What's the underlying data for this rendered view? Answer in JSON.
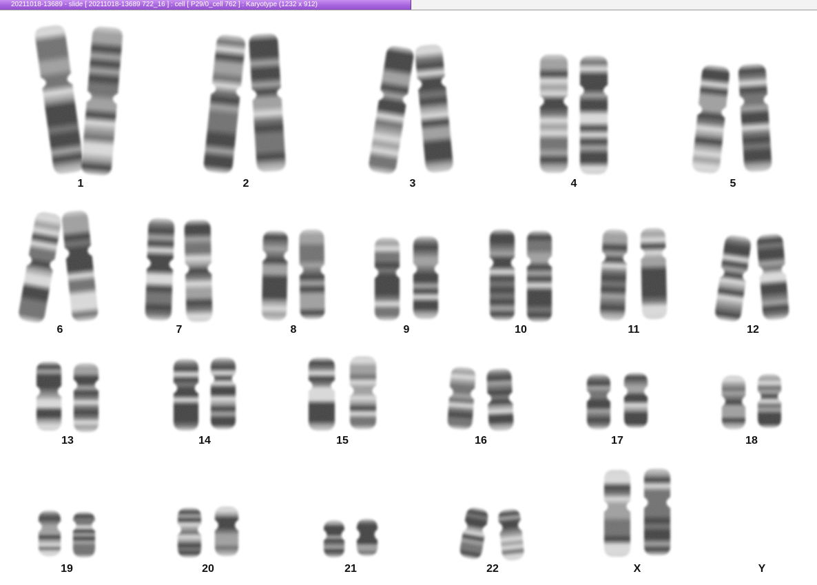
{
  "window": {
    "title": "20211018-13689 - slide [ 20211018-13689 722_16 ] : cell [ P29/0_cell 762 ] : Karyotype  (1232 x 912)"
  },
  "karyotype": {
    "labels": [
      "1",
      "2",
      "3",
      "4",
      "5",
      "6",
      "7",
      "8",
      "9",
      "10",
      "11",
      "12",
      "13",
      "14",
      "15",
      "16",
      "17",
      "18",
      "19",
      "20",
      "21",
      "22",
      "X",
      "Y"
    ],
    "pair_counts": [
      2,
      2,
      2,
      2,
      2,
      2,
      2,
      2,
      2,
      2,
      2,
      2,
      2,
      2,
      2,
      2,
      2,
      2,
      2,
      2,
      2,
      2,
      2,
      0
    ]
  },
  "colors": {
    "title_bar_start": "#c98ff0",
    "title_bar_end": "#9350cf",
    "chromosome_dark": "#3a3a3a",
    "chromosome_light": "#d6d6d6",
    "label_text": "#111111",
    "background": "#ffffff"
  }
}
